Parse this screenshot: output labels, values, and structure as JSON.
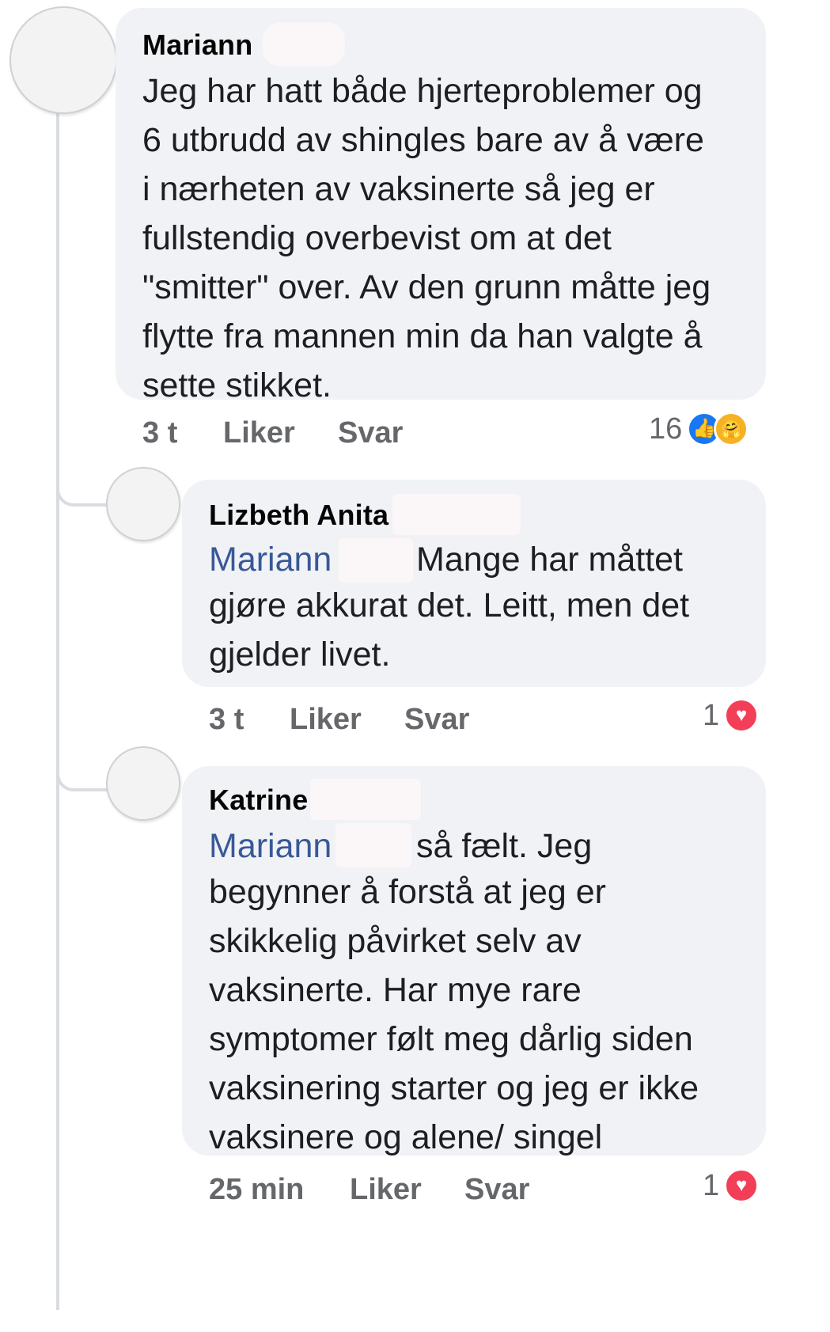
{
  "comments": [
    {
      "author": "Mariann",
      "text": "Jeg har hatt både hjerteproblemer og\n6 utbrudd av shingles bare av å være\ni nærheten av vaksinerte så jeg er\nfullstendig overbevist om at det\n\"smitter\" over. Av den grunn måtte jeg\nflytte fra mannen min da han valgte å\nsette stikket.",
      "time": "3 t",
      "like_label": "Liker",
      "reply_label": "Svar",
      "reaction_count": "16",
      "reactions": [
        "like-icon",
        "care-icon"
      ]
    },
    {
      "author": "Lizbeth Anita",
      "mention": "Mariann",
      "text_line1": "Mange har måttet",
      "text": "gjøre akkurat det. Leitt, men det\ngjelder livet.",
      "time": "3 t",
      "like_label": "Liker",
      "reply_label": "Svar",
      "reaction_count": "1",
      "reactions": [
        "love-icon"
      ]
    },
    {
      "author": "Katrine",
      "mention": "Mariann",
      "text_line1": "så fælt. Jeg",
      "text": "begynner å forstå at jeg er\nskikkelig påvirket selv av\nvaksinerte. Har mye rare\nsymptomer følt meg dårlig siden\nvaksinering starter og jeg er ikke\nvaksinere og alene/ singel",
      "time": "25 min",
      "like_label": "Liker",
      "reply_label": "Svar",
      "reaction_count": "1",
      "reactions": [
        "love-icon"
      ]
    }
  ],
  "icons": {
    "like": "👍",
    "care": "🤗",
    "love": "♥"
  },
  "colors": {
    "bubble": "#f0f2f5",
    "mention": "#385898",
    "meta": "#65676b",
    "like": "#1877f2",
    "love": "#f33e58"
  }
}
